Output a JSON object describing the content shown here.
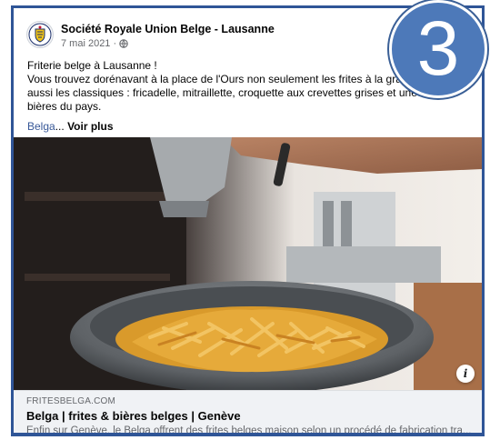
{
  "post": {
    "page_name": "Société Royale Union Belge - Lausanne",
    "date": "7 mai 2021 ·",
    "text_lines": [
      "Friterie belge à Lausanne !",
      "Vous trouvez dorénavant à la place de l'Ours non seulement les frites à la graisse",
      "aussi les classiques : fricadelle, mitraillette, croquette aux crevettes grises et une be",
      "bières du pays."
    ],
    "hashtag": "Belga",
    "ellipsis": "...",
    "see_more": "Voir plus"
  },
  "link_preview": {
    "domain": "FRITESBELGA.COM",
    "title": "Belga | frites & bières belges | Genève",
    "description": "Enfin sur Genève, le Belga offrent des frites belges maison selon un procédé de fabrication tra..."
  },
  "badge": {
    "number": "3"
  },
  "icons": {
    "avatar": "crest-icon",
    "privacy": "globe-icon",
    "info": "info-icon"
  },
  "colors": {
    "frame_border": "#2f5597",
    "badge_fill": "#4d79b9",
    "link_blue": "#385898"
  }
}
